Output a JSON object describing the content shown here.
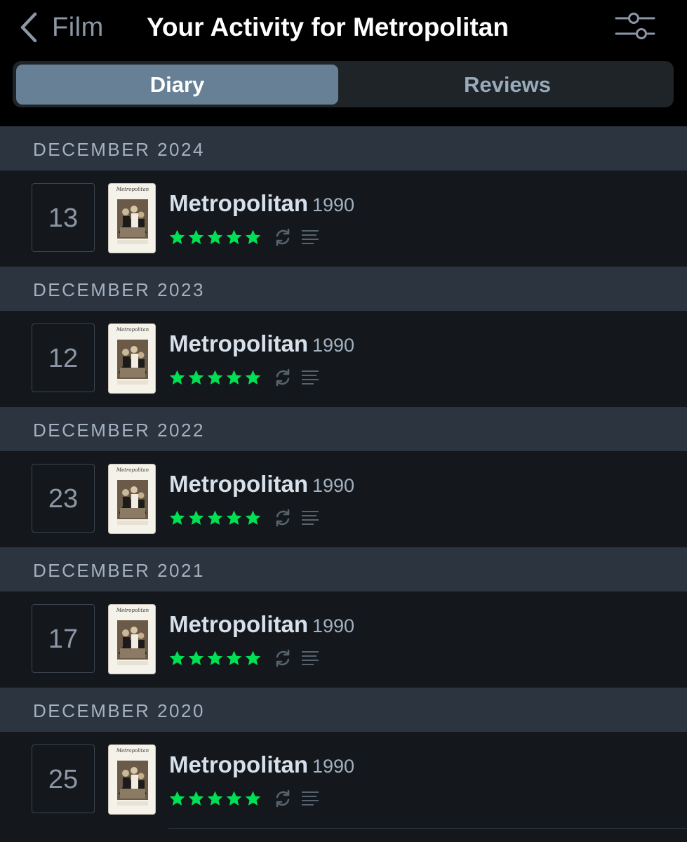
{
  "header": {
    "back_label": "Film",
    "title": "Your Activity for Metropolitan",
    "icons": {
      "back": "chevron-left-icon",
      "filter": "sliders-icon"
    }
  },
  "tabs": [
    {
      "label": "Diary",
      "active": true
    },
    {
      "label": "Reviews",
      "active": false
    }
  ],
  "colors": {
    "background": "#14181c",
    "header_bg": "#000000",
    "month_bg": "#2c3440",
    "tab_active": "#678096",
    "star": "#00e054"
  },
  "entries": [
    {
      "month": "DECEMBER 2024",
      "day": "13",
      "film": "Metropolitan",
      "year": "1990",
      "rating": 5,
      "rewatch": true,
      "has_review": true
    },
    {
      "month": "DECEMBER 2023",
      "day": "12",
      "film": "Metropolitan",
      "year": "1990",
      "rating": 5,
      "rewatch": true,
      "has_review": true
    },
    {
      "month": "DECEMBER 2022",
      "day": "23",
      "film": "Metropolitan",
      "year": "1990",
      "rating": 5,
      "rewatch": true,
      "has_review": true
    },
    {
      "month": "DECEMBER 2021",
      "day": "17",
      "film": "Metropolitan",
      "year": "1990",
      "rating": 5,
      "rewatch": true,
      "has_review": true
    },
    {
      "month": "DECEMBER 2020",
      "day": "25",
      "film": "Metropolitan",
      "year": "1990",
      "rating": 5,
      "rewatch": true,
      "has_review": true
    }
  ]
}
